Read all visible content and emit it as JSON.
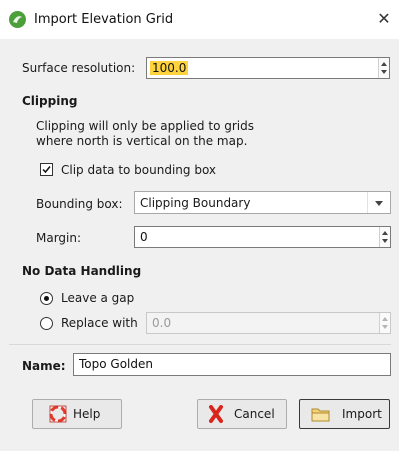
{
  "window": {
    "title": "Import Elevation Grid",
    "close_glyph": "✕"
  },
  "surface_resolution": {
    "label": "Surface resolution:",
    "value": "100.0"
  },
  "clipping": {
    "heading": "Clipping",
    "note_line1": "Clipping will only be applied to grids",
    "note_line2": "where north is vertical on the map.",
    "clip_checkbox_label": "Clip data to bounding box",
    "clip_checked": true,
    "bounding_box_label": "Bounding box:",
    "bounding_box_value": "Clipping Boundary",
    "margin_label": "Margin:",
    "margin_value": "0"
  },
  "no_data": {
    "heading": "No Data Handling",
    "leave_gap_label": "Leave a gap",
    "replace_with_label": "Replace with",
    "replace_value": "0.0",
    "selected": "leave_gap"
  },
  "name_field": {
    "label": "Name:",
    "value": "Topo Golden"
  },
  "buttons": {
    "help": "Help",
    "cancel": "Cancel",
    "import": "Import"
  },
  "colors": {
    "highlight": "#ffd33d",
    "app_icon": "#4c9f3a",
    "cancel_icon": "#d9261c",
    "help_icon": "#e23b2e"
  }
}
